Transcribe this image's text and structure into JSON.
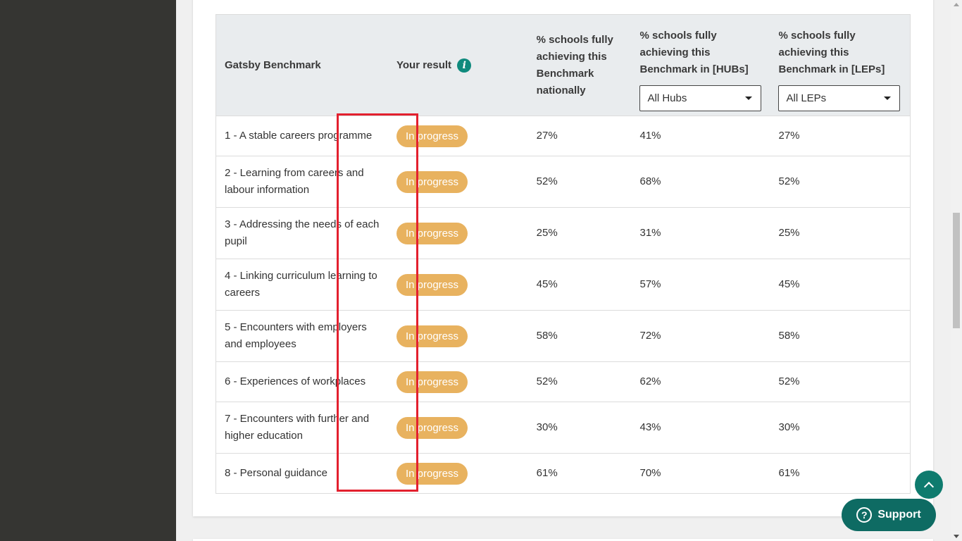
{
  "table": {
    "headers": {
      "benchmark": "Gatsby Benchmark",
      "your_result": "Your result",
      "national": "% schools fully achieving this Benchmark nationally",
      "hubs": "% schools fully achieving this Benchmark in [HUBs]",
      "leps": "% schools fully achieving this Benchmark in [LEPs]"
    },
    "filters": {
      "hubs_selected": "All Hubs",
      "leps_selected": "All LEPs"
    },
    "rows": [
      {
        "benchmark": "1 - A stable careers programme",
        "result": "In progress",
        "national": "27%",
        "hubs": "41%",
        "leps": "27%"
      },
      {
        "benchmark": "2 - Learning from careers and labour information",
        "result": "In progress",
        "national": "52%",
        "hubs": "68%",
        "leps": "52%"
      },
      {
        "benchmark": "3 - Addressing the needs of each pupil",
        "result": "In progress",
        "national": "25%",
        "hubs": "31%",
        "leps": "25%"
      },
      {
        "benchmark": "4 - Linking curriculum learning to careers",
        "result": "In progress",
        "national": "45%",
        "hubs": "57%",
        "leps": "45%"
      },
      {
        "benchmark": "5 - Encounters with employers and employees",
        "result": "In progress",
        "national": "58%",
        "hubs": "72%",
        "leps": "58%"
      },
      {
        "benchmark": "6 - Experiences of workplaces",
        "result": "In progress",
        "national": "52%",
        "hubs": "62%",
        "leps": "52%"
      },
      {
        "benchmark": "7 - Encounters with further and higher education",
        "result": "In progress",
        "national": "30%",
        "hubs": "43%",
        "leps": "30%"
      },
      {
        "benchmark": "8 - Personal guidance",
        "result": "In progress",
        "national": "61%",
        "hubs": "70%",
        "leps": "61%"
      }
    ]
  },
  "icons": {
    "info": "info-icon",
    "to_top": "chevron-up-icon",
    "support": "question-icon"
  },
  "support_label": "Support",
  "colors": {
    "accent": "#0e6b63",
    "badge": "#e8b25f",
    "highlight": "#e3202e"
  }
}
